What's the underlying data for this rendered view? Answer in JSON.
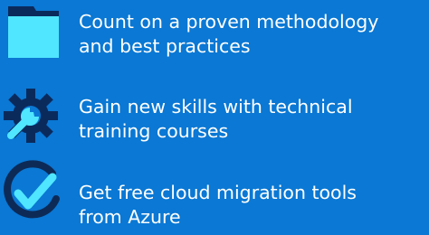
{
  "colors": {
    "background": "#0a78d4",
    "icon_fill": "#50e6ff",
    "icon_dark": "#0b2a5c",
    "icon_ring": "#0d2a57",
    "text": "#ffffff"
  },
  "features": [
    {
      "icon": "folder-icon",
      "line1": "Count on a proven methodology",
      "line2": "and best practices"
    },
    {
      "icon": "gear-wrench-icon",
      "line1": "Gain new skills with technical",
      "line2": "training courses"
    },
    {
      "icon": "check-circle-icon",
      "line1": "Get free cloud migration tools",
      "line2": "from Azure"
    }
  ]
}
